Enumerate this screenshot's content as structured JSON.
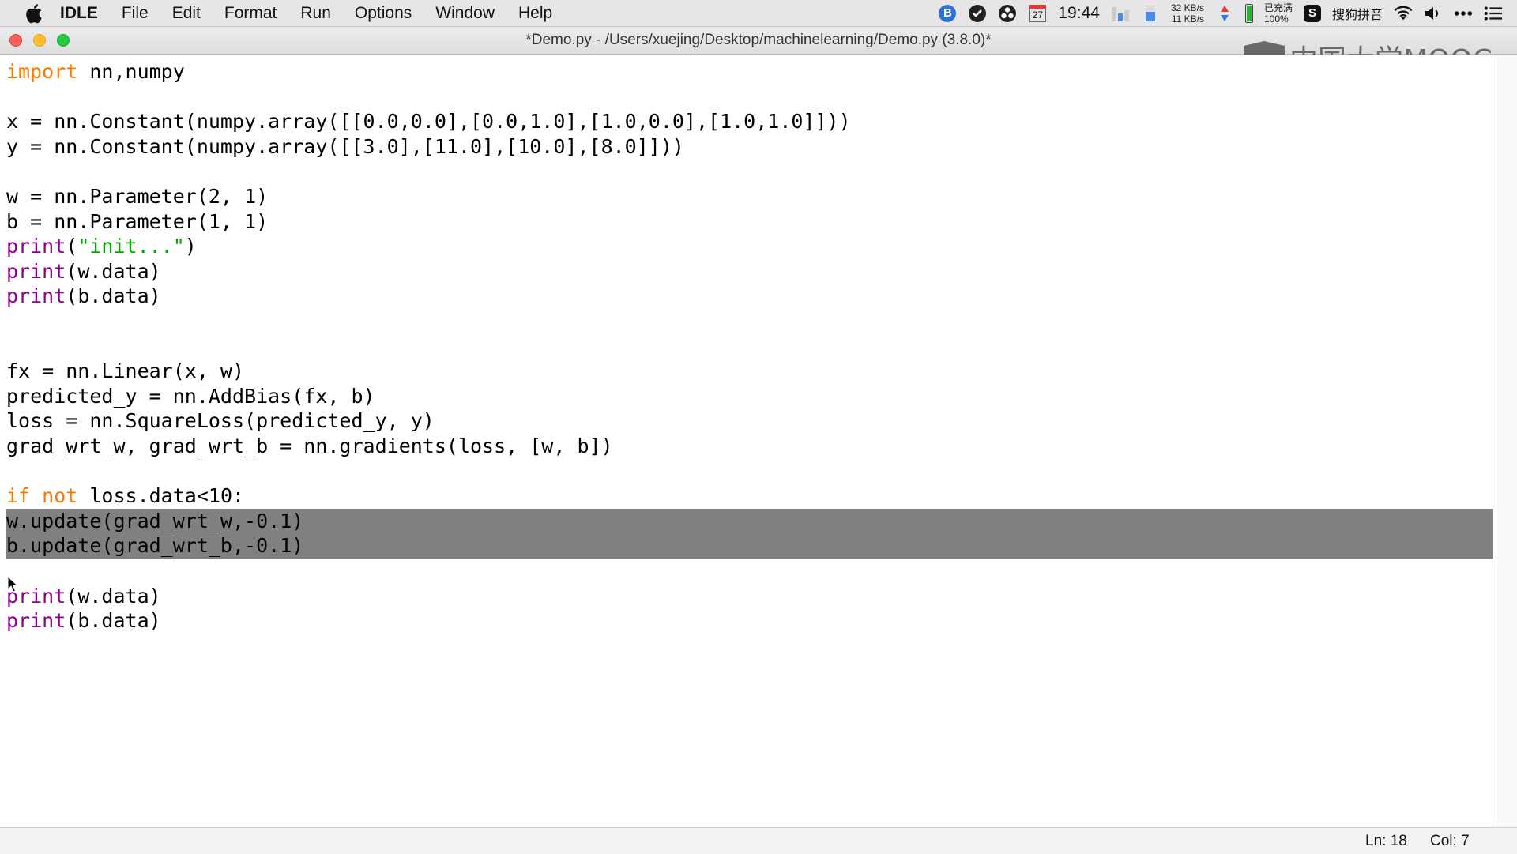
{
  "menubar": {
    "app": "IDLE",
    "items": [
      "File",
      "Edit",
      "Format",
      "Run",
      "Options",
      "Window",
      "Help"
    ],
    "status": {
      "bluetooth_letter": "B",
      "calendar_day": "27",
      "time": "19:44",
      "net_up": "32 KB/s",
      "net_down": "11 KB/s",
      "battery_status": "已充满",
      "battery_percent": "100%",
      "ime_letter": "S",
      "ime_name": "搜狗拼音"
    }
  },
  "window": {
    "title": "*Demo.py - /Users/xuejing/Desktop/machinelearning/Demo.py (3.8.0)*"
  },
  "watermark": {
    "text": "中国大学MOOC"
  },
  "editor": {
    "selected_lines": [
      18,
      19
    ],
    "lines": [
      {
        "n": 1,
        "spans": [
          {
            "t": "import",
            "c": "kw"
          },
          {
            "t": " nn,numpy",
            "c": ""
          }
        ]
      },
      {
        "n": 3,
        "spans": [
          {
            "t": "x = nn.Constant(numpy.array([[0.0,0.0],[0.0,1.0],[1.0,0.0],[1.0,1.0]]))",
            "c": ""
          }
        ]
      },
      {
        "n": 4,
        "spans": [
          {
            "t": "y = nn.Constant(numpy.array([[3.0],[11.0],[10.0],[8.0]]))",
            "c": ""
          }
        ]
      },
      {
        "n": 6,
        "spans": [
          {
            "t": "w = nn.Parameter(2, 1)",
            "c": ""
          }
        ]
      },
      {
        "n": 7,
        "spans": [
          {
            "t": "b = nn.Parameter(1, 1)",
            "c": ""
          }
        ]
      },
      {
        "n": 8,
        "spans": [
          {
            "t": "print",
            "c": "bi"
          },
          {
            "t": "(",
            "c": ""
          },
          {
            "t": "\"init...\"",
            "c": "str"
          },
          {
            "t": ")",
            "c": ""
          }
        ]
      },
      {
        "n": 9,
        "spans": [
          {
            "t": "print",
            "c": "bi"
          },
          {
            "t": "(w.data)",
            "c": ""
          }
        ]
      },
      {
        "n": 10,
        "spans": [
          {
            "t": "print",
            "c": "bi"
          },
          {
            "t": "(b.data)",
            "c": ""
          }
        ]
      },
      {
        "n": 13,
        "spans": [
          {
            "t": "fx = nn.Linear(x, w)",
            "c": ""
          }
        ]
      },
      {
        "n": 14,
        "spans": [
          {
            "t": "predicted_y = nn.AddBias(fx, b)",
            "c": ""
          }
        ]
      },
      {
        "n": 15,
        "spans": [
          {
            "t": "loss = nn.SquareLoss(predicted_y, y)",
            "c": ""
          }
        ]
      },
      {
        "n": 16,
        "spans": [
          {
            "t": "grad_wrt_w, grad_wrt_b = nn.gradients(loss, [w, b])",
            "c": ""
          }
        ]
      },
      {
        "n": 18,
        "spans": [
          {
            "t": "if",
            "c": "kw"
          },
          {
            "t": " ",
            "c": ""
          },
          {
            "t": "not",
            "c": "kw"
          },
          {
            "t": " loss.data<10:",
            "c": ""
          }
        ]
      },
      {
        "n": 19,
        "spans": [
          {
            "t": "w.update(grad_wrt_w,-0.1)",
            "c": ""
          }
        ]
      },
      {
        "n": 20,
        "spans": [
          {
            "t": "b.update(grad_wrt_b,-0.1)",
            "c": ""
          }
        ]
      },
      {
        "n": 22,
        "spans": [
          {
            "t": "print",
            "c": "bi"
          },
          {
            "t": "(w.data)",
            "c": ""
          }
        ]
      },
      {
        "n": 23,
        "spans": [
          {
            "t": "print",
            "c": "bi"
          },
          {
            "t": "(b.data)",
            "c": ""
          }
        ]
      }
    ]
  },
  "statusbar": {
    "line": "Ln: 18",
    "col": "Col: 7"
  },
  "colors": {
    "keyword": "#ff7700",
    "builtin": "#900090",
    "string": "#00aa00",
    "selection": "#808080"
  }
}
